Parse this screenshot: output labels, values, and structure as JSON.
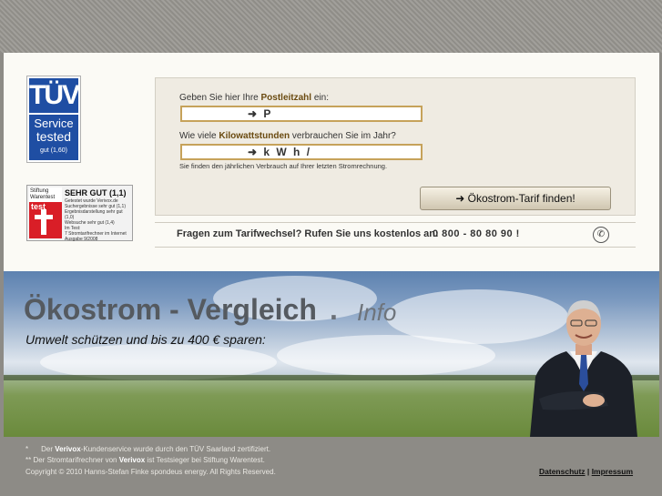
{
  "badges": {
    "tuv": {
      "logo": "TÜV",
      "line1": "Service",
      "line2": "tested",
      "rating": "gut (1,60)"
    },
    "stiftung_warentest": {
      "caption": "Stiftung Warentest",
      "brand": "test",
      "verdict": "SEHR GUT (1,1)",
      "detail1": "Getestet wurde Verivox.de",
      "detail2": "Suchergebnisse sehr gut (1,1)",
      "detail3": "Ergebnisdarstellung sehr gut (1,0)",
      "detail4": "Websuche sehr gut (1,4)",
      "detail5": "Im Test:",
      "detail6": "7 Stromtarifrechner im Internet",
      "issue": "Ausgabe 9/2008"
    }
  },
  "form": {
    "postcode_label_pre": "Geben Sie hier Ihre ",
    "postcode_label_bold": "Postleitzahl",
    "postcode_label_post": " ein:",
    "postcode_value": "➜ P",
    "kwh_label_pre": "Wie viele ",
    "kwh_label_bold": "Kilowattstunden",
    "kwh_label_post": " verbrauchen Sie im Jahr?",
    "kwh_value": "➜ k W h  /",
    "hint": "Sie finden den jährlichen Verbrauch auf Ihrer letzten Stromrechnung.",
    "submit_label": "➜ Ökostrom-Tarif finden!"
  },
  "phone": {
    "question": "Fragen zum Tarifwechsel? Rufen Sie uns kostenlos an:",
    "number": "0 800 - 80 80 90  !"
  },
  "hero": {
    "title": "Ökostrom - Vergleich",
    "dot": ".",
    "info": "Info",
    "subtitle": "Umwelt schützen und bis zu 400 € sparen:"
  },
  "footer": {
    "note1_mark": "*",
    "note1_pre": "Der ",
    "note1_bold": "Verivox",
    "note1_post": "-Kundenservice wurde durch den TÜV Saarland zertifiziert.",
    "note2_mark": "**",
    "note2_pre": "Der Stromtarifrechner von ",
    "note2_bold": "Verivox",
    "note2_post": " ist Testsieger bei Stiftung Warentest.",
    "copyright": "Copyright © 2010 Hanns-Stefan Finke spondeus energy. All Rights Reserved.",
    "link_privacy": "Datenschutz",
    "separator": "|",
    "link_imprint": "Impressum"
  }
}
